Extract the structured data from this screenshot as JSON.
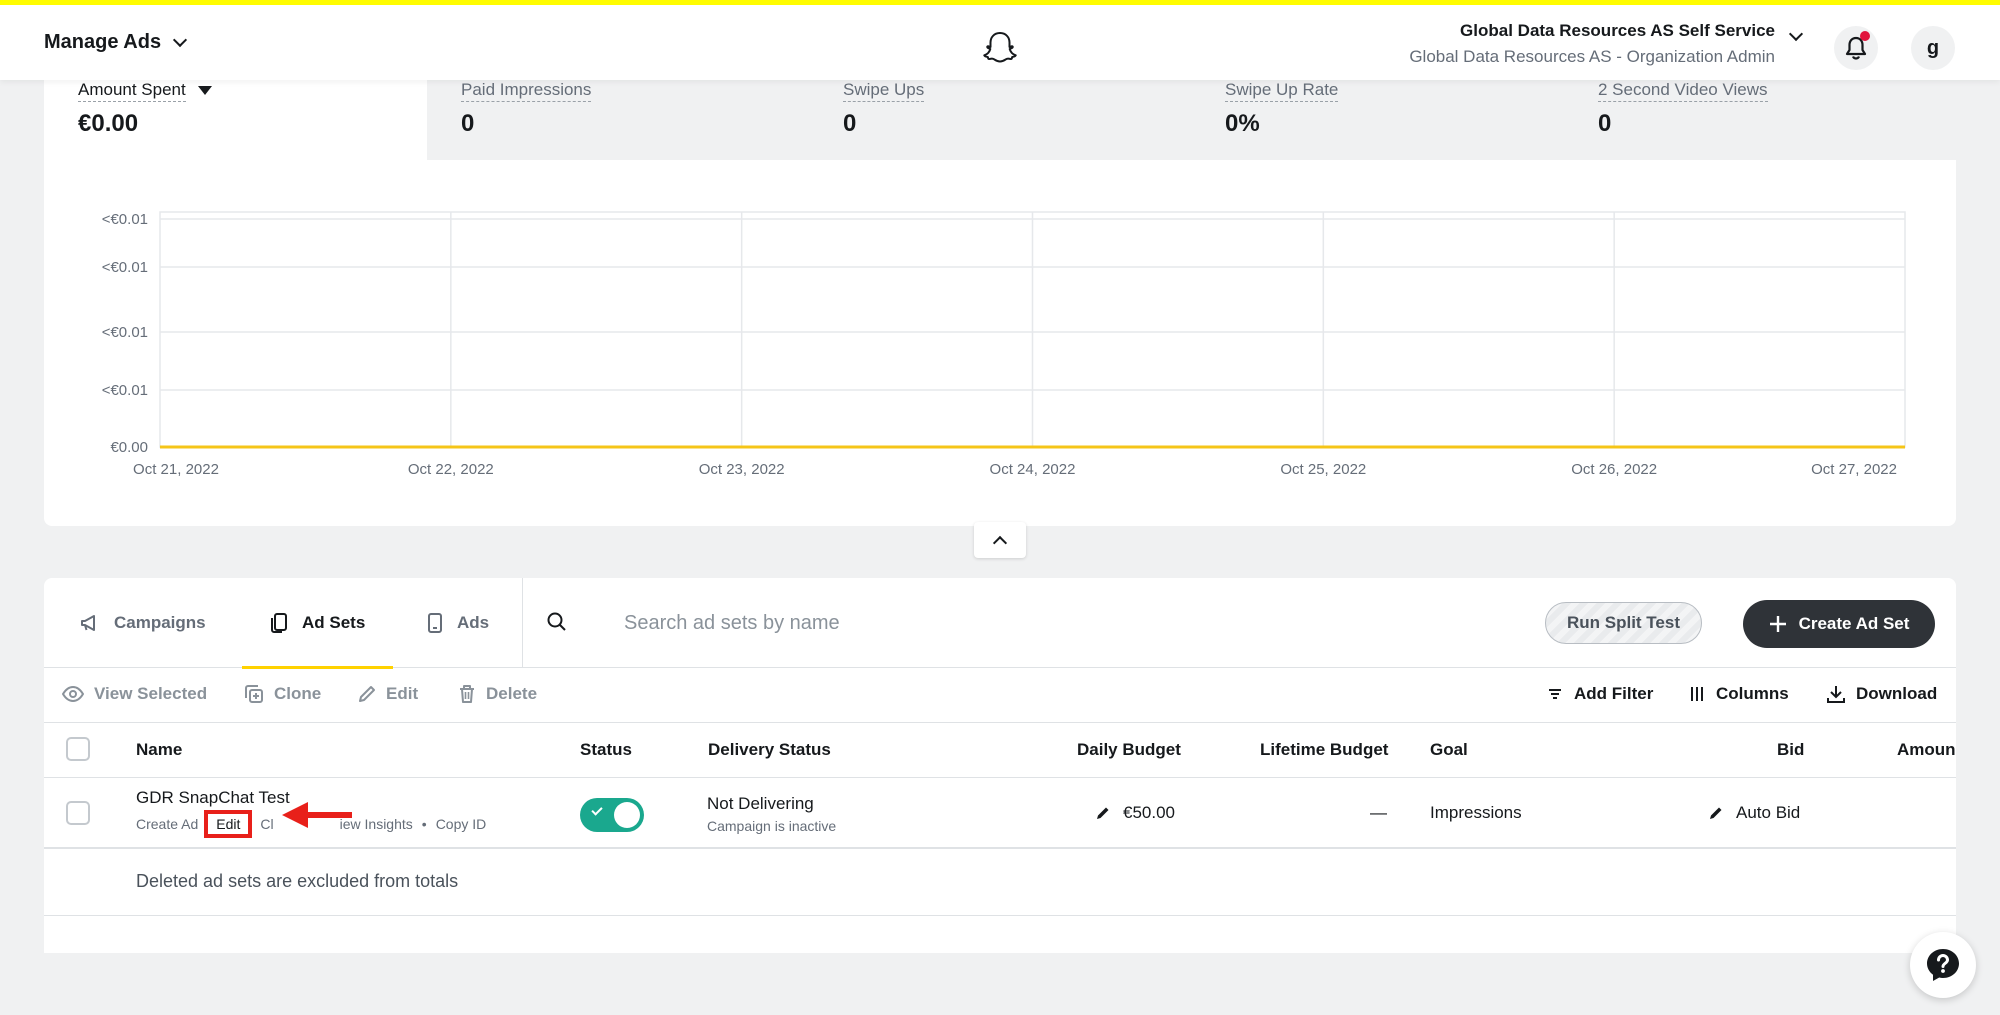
{
  "topbar": {
    "title": "Manage Ads",
    "org_name": "Global Data Resources AS Self Service",
    "org_role": "Global Data Resources AS - Organization Admin",
    "avatar_initial": "g",
    "accent_color": "#fffc00"
  },
  "metrics": [
    {
      "label": "Amount Spent",
      "value": "€0.00",
      "active": true
    },
    {
      "label": "Paid Impressions",
      "value": "0"
    },
    {
      "label": "Swipe Ups",
      "value": "0"
    },
    {
      "label": "Swipe Up Rate",
      "value": "0%"
    },
    {
      "label": "2 Second Video Views",
      "value": "0"
    }
  ],
  "chart_data": {
    "type": "line",
    "x": [
      "Oct 21, 2022",
      "Oct 22, 2022",
      "Oct 23, 2022",
      "Oct 24, 2022",
      "Oct 25, 2022",
      "Oct 26, 2022",
      "Oct 27, 2022"
    ],
    "y_tick_labels": [
      "€0.00",
      "<€0.01",
      "<€0.01",
      "<€0.01",
      "<€0.01"
    ],
    "series": [
      {
        "values": [
          0,
          0,
          0,
          0,
          0,
          0,
          0
        ],
        "color": "#f5c518"
      }
    ],
    "grid": true
  },
  "tabs": [
    {
      "label": "Campaigns",
      "icon": "megaphone-icon"
    },
    {
      "label": "Ad Sets",
      "icon": "ad-sets-icon",
      "active": true
    },
    {
      "label": "Ads",
      "icon": "phone-icon"
    }
  ],
  "search": {
    "placeholder": "Search ad sets by name"
  },
  "buttons": {
    "split_test": "Run Split Test",
    "create": "Create Ad Set"
  },
  "toolbar": {
    "view_selected": "View Selected",
    "clone": "Clone",
    "edit": "Edit",
    "delete": "Delete",
    "add_filter": "Add Filter",
    "columns": "Columns",
    "download": "Download"
  },
  "table": {
    "headers": {
      "name": "Name",
      "status": "Status",
      "delivery": "Delivery Status",
      "daily_budget": "Daily Budget",
      "lifetime_budget": "Lifetime Budget",
      "goal": "Goal",
      "bid": "Bid",
      "amount": "Amoun"
    },
    "rows": [
      {
        "name": "GDR SnapChat Test",
        "actions": {
          "create_ad": "Create Ad",
          "edit": "Edit",
          "clone_partial": "Cl",
          "view_insights_partial": "iew Insights",
          "copy_id": "Copy ID",
          "sep": "•"
        },
        "status_on": true,
        "delivery": "Not Delivering",
        "delivery_sub": "Campaign is inactive",
        "daily_budget": "€50.00",
        "lifetime_budget": "—",
        "goal": "Impressions",
        "bid": "Auto Bid"
      }
    ],
    "footer": "Deleted ad sets are excluded from totals"
  }
}
